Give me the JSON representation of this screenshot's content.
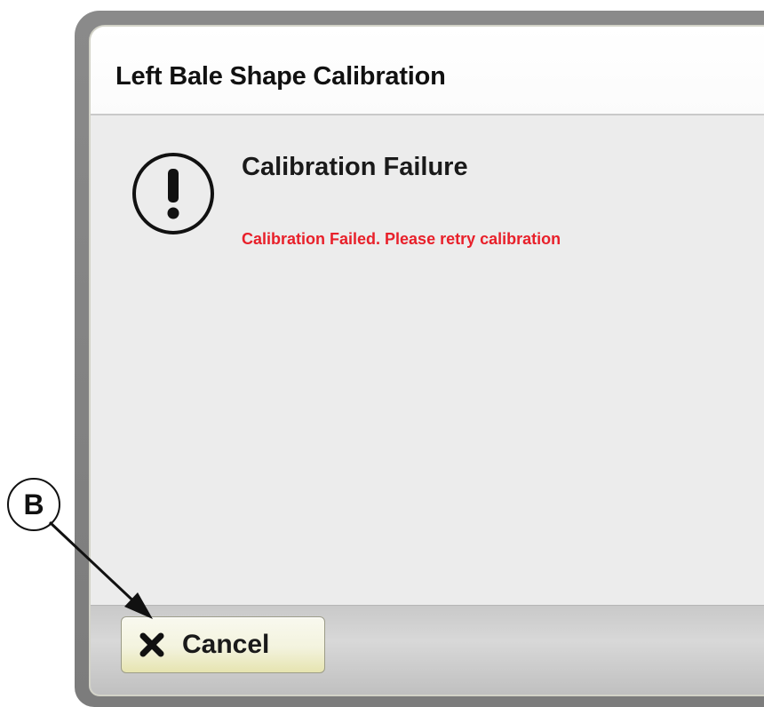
{
  "dialog": {
    "title": "Left Bale Shape Calibration",
    "icon": "alert-circle-icon",
    "heading": "Calibration Failure",
    "message": "Calibration Failed. Please retry calibration",
    "message_color": "#e8202a"
  },
  "footer": {
    "cancel_icon": "close-x-icon",
    "cancel_label": "Cancel"
  },
  "callout": {
    "letter": "B"
  }
}
